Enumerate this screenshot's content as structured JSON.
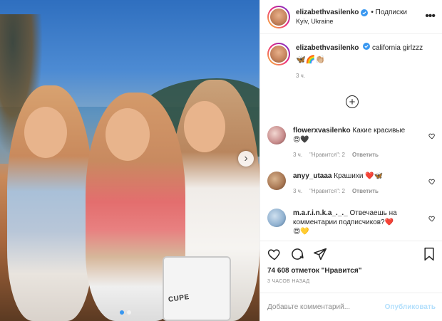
{
  "post": {
    "username": "elizabethvasilenko",
    "follow_label": "• Подписки",
    "location": "Kyiv, Ukraine",
    "more_label": "•••",
    "image_text": "CUPE"
  },
  "caption": {
    "username": "elizabethvasilenko",
    "text": "california girlzzz",
    "emojis": "🦋🌈👏🏼",
    "time": "3 ч."
  },
  "load_more_label": "+",
  "comments": [
    {
      "username": "flowerxvasilenko",
      "text": "Какие красивые",
      "emojis": "😍🖤",
      "time": "3 ч.",
      "likes": "\"Нравится\": 2",
      "reply": "Ответить"
    },
    {
      "username": "anyy_utaaa",
      "text": "Крашихи ❤️🦋",
      "emojis": "",
      "time": "3 ч.",
      "likes": "\"Нравится\": 2",
      "reply": "Ответить"
    },
    {
      "username": "m.a.r.i.n.k.a_._._",
      "text": "Отвечаешь на комментарии подписчиков?❤️",
      "emojis": "😍💛",
      "time": "",
      "likes": "",
      "reply": ""
    }
  ],
  "likes": "74 608 отметок \"Нравится\"",
  "posted_ago": "3 ЧАСОВ НАЗАД",
  "add_comment": {
    "placeholder": "Добавьте комментарий...",
    "publish_label": "Опубликовать"
  },
  "colors": {
    "verified": "#3897f0",
    "publish_disabled": "#b2dffc",
    "active_dot": "#3897f0"
  },
  "icons": [
    "verified-icon",
    "more-icon",
    "plus-circle-icon",
    "heart-icon",
    "comment-icon",
    "share-icon",
    "bookmark-icon",
    "chevron-right-icon"
  ]
}
